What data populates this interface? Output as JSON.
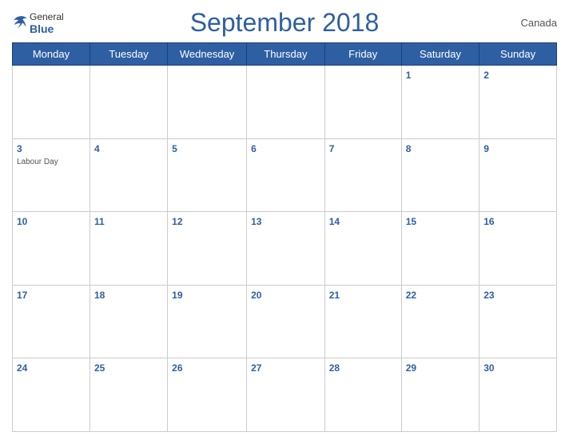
{
  "header": {
    "logo_general": "General",
    "logo_blue": "Blue",
    "title": "September 2018",
    "country": "Canada"
  },
  "weekdays": [
    "Monday",
    "Tuesday",
    "Wednesday",
    "Thursday",
    "Friday",
    "Saturday",
    "Sunday"
  ],
  "weeks": [
    [
      {
        "day": "",
        "empty": true
      },
      {
        "day": "",
        "empty": true
      },
      {
        "day": "",
        "empty": true
      },
      {
        "day": "",
        "empty": true
      },
      {
        "day": "",
        "empty": true
      },
      {
        "day": "1"
      },
      {
        "day": "2"
      }
    ],
    [
      {
        "day": "3",
        "holiday": "Labour Day"
      },
      {
        "day": "4"
      },
      {
        "day": "5"
      },
      {
        "day": "6"
      },
      {
        "day": "7"
      },
      {
        "day": "8"
      },
      {
        "day": "9"
      }
    ],
    [
      {
        "day": "10"
      },
      {
        "day": "11"
      },
      {
        "day": "12"
      },
      {
        "day": "13"
      },
      {
        "day": "14"
      },
      {
        "day": "15"
      },
      {
        "day": "16"
      }
    ],
    [
      {
        "day": "17"
      },
      {
        "day": "18"
      },
      {
        "day": "19"
      },
      {
        "day": "20"
      },
      {
        "day": "21"
      },
      {
        "day": "22"
      },
      {
        "day": "23"
      }
    ],
    [
      {
        "day": "24"
      },
      {
        "day": "25"
      },
      {
        "day": "26"
      },
      {
        "day": "27"
      },
      {
        "day": "28"
      },
      {
        "day": "29"
      },
      {
        "day": "30"
      }
    ]
  ]
}
